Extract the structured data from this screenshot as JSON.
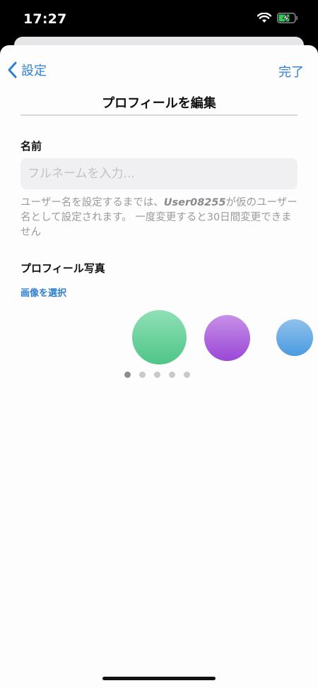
{
  "status_bar": {
    "time": "17:27"
  },
  "nav": {
    "back_label": "設定",
    "done_label": "完了",
    "title": "プロフィールを編集"
  },
  "name_section": {
    "label": "名前",
    "input_value": "",
    "input_placeholder": "フルネームを入力...",
    "help_prefix": "ユーザー名を設定するまでは、",
    "help_username": "User08255",
    "help_suffix": "が仮のユーザー名として設定されます。 一度変更すると30日間変更できません"
  },
  "photo_section": {
    "label": "プロフィール写真",
    "select_image_label": "画像を選択",
    "swatches": [
      "green",
      "purple",
      "blue"
    ],
    "page_count": 5,
    "current_page": 1
  },
  "colors": {
    "accent": "#2f7fd1",
    "green": "#5ccb92",
    "purple": "#a85ddb",
    "blue": "#5ea7e4"
  }
}
